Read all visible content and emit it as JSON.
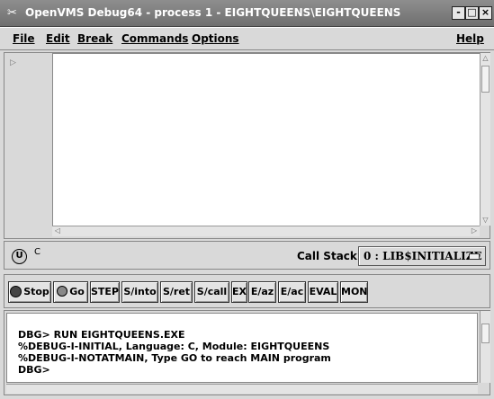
{
  "window": {
    "title": "OpenVMS Debug64 - process 1 - EIGHTQUEENS\\EIGHTQUEENS",
    "min_label": "-",
    "max_label": "□",
    "close_label": "×"
  },
  "menubar": {
    "items": [
      {
        "label": "File"
      },
      {
        "label": "Edit"
      },
      {
        "label": "Break"
      },
      {
        "label": "Commands"
      },
      {
        "label": "Options"
      }
    ],
    "help": "Help"
  },
  "status": {
    "language": "C",
    "callstack_label": "Call Stack:",
    "callstack_value": "0 : LIB$INITIALIZE"
  },
  "toolbar": {
    "buttons": [
      {
        "label": "Stop"
      },
      {
        "label": "Go"
      },
      {
        "label": "STEP"
      },
      {
        "label": "S/into"
      },
      {
        "label": "S/ret"
      },
      {
        "label": "S/call"
      },
      {
        "label": "EX"
      },
      {
        "label": "E/az"
      },
      {
        "label": "E/ac"
      },
      {
        "label": "EVAL"
      },
      {
        "label": "MON"
      }
    ]
  },
  "command_output": {
    "lines": [
      "DBG> RUN EIGHTQUEENS.EXE",
      "%DEBUG-I-INITIAL, Language: C, Module: EIGHTQUEENS",
      "%DEBUG-I-NOTATMAIN, Type GO to reach MAIN program",
      "DBG>"
    ]
  }
}
